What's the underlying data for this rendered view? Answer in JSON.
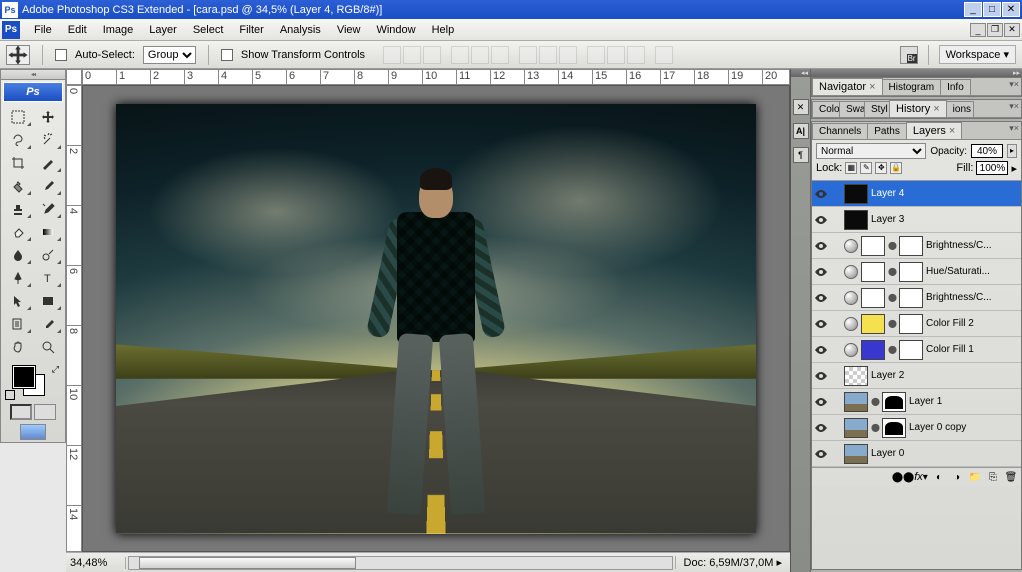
{
  "title": "Adobe Photoshop CS3 Extended - [cara.psd @ 34,5% (Layer 4, RGB/8#)]",
  "menus": [
    "File",
    "Edit",
    "Image",
    "Layer",
    "Select",
    "Filter",
    "Analysis",
    "View",
    "Window",
    "Help"
  ],
  "options": {
    "auto_select_label": "Auto-Select:",
    "auto_select_value": "Group",
    "show_transform_label": "Show Transform Controls",
    "workspace_label": "Workspace ▾"
  },
  "toolbox_badge": "Ps",
  "ruler_h": [
    "0",
    "1",
    "2",
    "3",
    "4",
    "5",
    "6",
    "7",
    "8",
    "9",
    "10",
    "11",
    "12",
    "13",
    "14",
    "15",
    "16",
    "17",
    "18",
    "19",
    "20"
  ],
  "ruler_v": [
    "0",
    "2",
    "4",
    "6",
    "8",
    "10",
    "12",
    "14"
  ],
  "status": {
    "zoom": "34,48%",
    "docsize_label": "Doc:",
    "docsize": "6,59M/37,0M"
  },
  "panel_nav": {
    "tabs": [
      "Navigator",
      "Histogram",
      "Info"
    ],
    "active": 0
  },
  "panel_style": {
    "tabs": [
      "Colo",
      "Swa",
      "Styl",
      "History",
      "ions"
    ],
    "active": 3
  },
  "panel_layers": {
    "tabs": [
      "Channels",
      "Paths",
      "Layers"
    ],
    "active": 2,
    "blend_mode": "Normal",
    "opacity_label": "Opacity:",
    "opacity": "40%",
    "lock_label": "Lock:",
    "fill_label": "Fill:",
    "fill": "100%",
    "layers": [
      {
        "name": "Layer 4",
        "thumb": "dark",
        "selected": true
      },
      {
        "name": "Layer 3",
        "thumb": "dark"
      },
      {
        "name": "Brightness/C...",
        "thumb": "white",
        "adj": true,
        "mask": true
      },
      {
        "name": "Hue/Saturati...",
        "thumb": "white",
        "adj": true,
        "mask": true
      },
      {
        "name": "Brightness/C...",
        "thumb": "white",
        "adj": true,
        "mask": true
      },
      {
        "name": "Color Fill 2",
        "thumb": "yellow",
        "adj": true,
        "mask": true
      },
      {
        "name": "Color Fill 1",
        "thumb": "blue",
        "adj": true,
        "mask": true
      },
      {
        "name": "Layer 2",
        "thumb": "checker"
      },
      {
        "name": "Layer 1",
        "thumb": "img",
        "mask": "shape"
      },
      {
        "name": "Layer 0 copy",
        "thumb": "img",
        "mask": "shape2"
      },
      {
        "name": "Layer 0",
        "thumb": "img"
      }
    ]
  }
}
